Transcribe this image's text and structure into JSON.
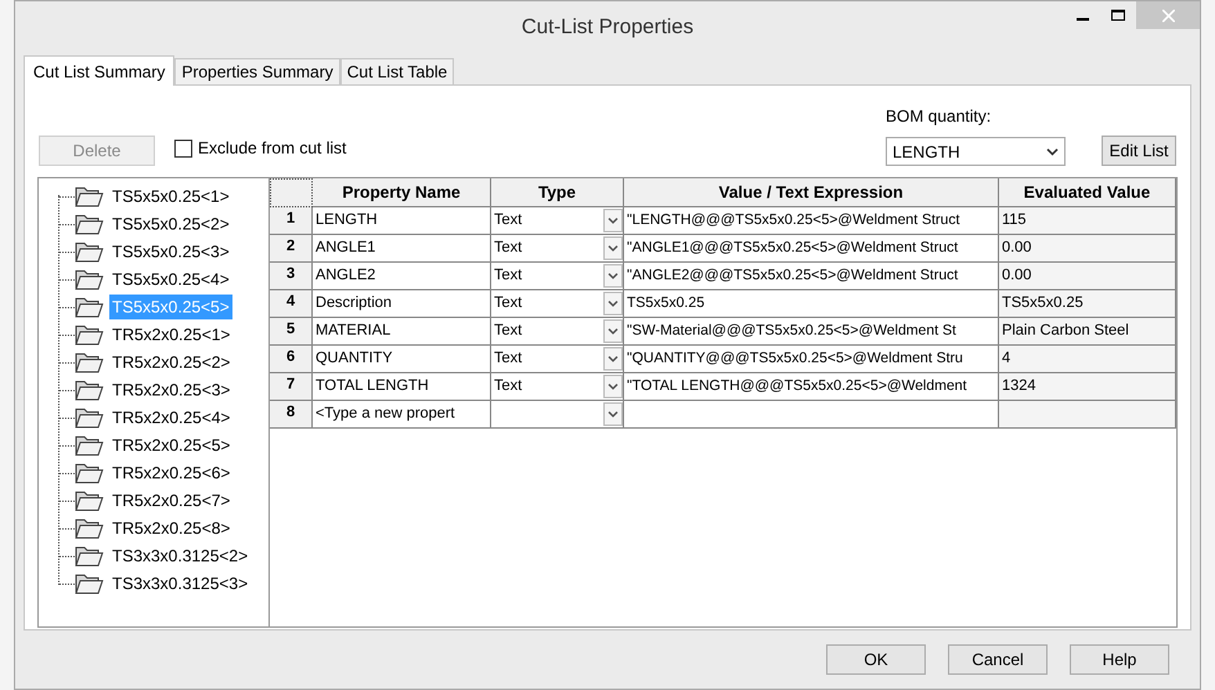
{
  "window": {
    "title": "Cut-List Properties"
  },
  "tabs": [
    {
      "label": "Cut List Summary",
      "selected": true
    },
    {
      "label": "Properties Summary",
      "selected": false
    },
    {
      "label": "Cut List Table",
      "selected": false
    }
  ],
  "toolbar": {
    "delete_button": {
      "label": "Delete",
      "disabled": true
    },
    "exclude_checkbox": {
      "label": "Exclude from cut list",
      "checked": false
    },
    "bom_quantity": {
      "label": "BOM quantity:",
      "value": "LENGTH"
    },
    "edit_list_button": "Edit List"
  },
  "tree": [
    {
      "label": "TS5x5x0.25<1>",
      "selected": false
    },
    {
      "label": "TS5x5x0.25<2>",
      "selected": false
    },
    {
      "label": "TS5x5x0.25<3>",
      "selected": false
    },
    {
      "label": "TS5x5x0.25<4>",
      "selected": false
    },
    {
      "label": "TS5x5x0.25<5>",
      "selected": true
    },
    {
      "label": "TR5x2x0.25<1>",
      "selected": false
    },
    {
      "label": "TR5x2x0.25<2>",
      "selected": false
    },
    {
      "label": "TR5x2x0.25<3>",
      "selected": false
    },
    {
      "label": "TR5x2x0.25<4>",
      "selected": false
    },
    {
      "label": "TR5x2x0.25<5>",
      "selected": false
    },
    {
      "label": "TR5x2x0.25<6>",
      "selected": false
    },
    {
      "label": "TR5x2x0.25<7>",
      "selected": false
    },
    {
      "label": "TR5x2x0.25<8>",
      "selected": false
    },
    {
      "label": "TS3x3x0.3125<2>",
      "selected": false
    },
    {
      "label": "TS3x3x0.3125<3>",
      "selected": false
    }
  ],
  "table": {
    "columns": [
      "Property Name",
      "Type",
      "Value / Text Expression",
      "Evaluated Value"
    ],
    "rows": [
      {
        "number": "1",
        "name": "LENGTH",
        "type": "Text",
        "value": "\"LENGTH@@@TS5x5x0.25<5>@Weldment Struct",
        "evaluated": "115"
      },
      {
        "number": "2",
        "name": "ANGLE1",
        "type": "Text",
        "value": "\"ANGLE1@@@TS5x5x0.25<5>@Weldment Struct",
        "evaluated": "0.00"
      },
      {
        "number": "3",
        "name": "ANGLE2",
        "type": "Text",
        "value": "\"ANGLE2@@@TS5x5x0.25<5>@Weldment Struct",
        "evaluated": "0.00"
      },
      {
        "number": "4",
        "name": "Description",
        "type": "Text",
        "value": "TS5x5x0.25",
        "evaluated": "TS5x5x0.25"
      },
      {
        "number": "5",
        "name": "MATERIAL",
        "type": "Text",
        "value": "\"SW-Material@@@TS5x5x0.25<5>@Weldment St",
        "evaluated": "Plain Carbon Steel"
      },
      {
        "number": "6",
        "name": "QUANTITY",
        "type": "Text",
        "value": "\"QUANTITY@@@TS5x5x0.25<5>@Weldment Stru",
        "evaluated": "4"
      },
      {
        "number": "7",
        "name": "TOTAL LENGTH",
        "type": "Text",
        "value": "\"TOTAL LENGTH@@@TS5x5x0.25<5>@Weldment",
        "evaluated": "1324"
      },
      {
        "number": "8",
        "name": "<Type a new propert",
        "type": "",
        "value": "",
        "evaluated": ""
      }
    ]
  },
  "buttons": [
    "OK",
    "Cancel",
    "Help"
  ]
}
